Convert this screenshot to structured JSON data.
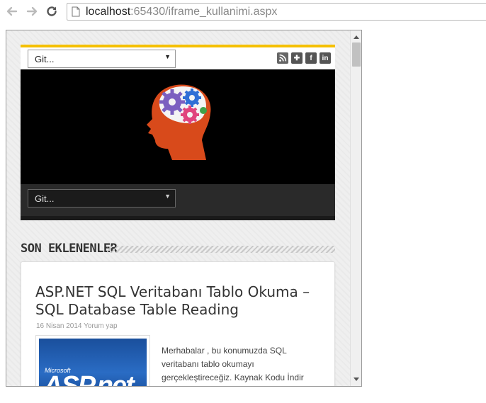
{
  "browser": {
    "url_host": "localhost",
    "url_port": ":65430",
    "url_path": "/iframe_kullanimi.aspx"
  },
  "site": {
    "select_top": "Git...",
    "select_bottom": "Git...",
    "social_icons": [
      "rss-icon",
      "plus-icon",
      "facebook-icon",
      "linkedin-icon"
    ]
  },
  "section": {
    "title": "SON EKLENENLER"
  },
  "post": {
    "title": "ASP.NET SQL Veritabanı Tablo Okuma – SQL Database Table Reading",
    "date": "16 Nisan 2014",
    "comment": "Yorum yap",
    "thumb_brand": "Microsoft",
    "thumb_text": "ASP.net",
    "excerpt": "Merhabalar , bu konumuzda  SQL veritabanı  tablo okumayı gerçekleştireceğiz. Kaynak Kodu İndir"
  },
  "colors": {
    "accent": "#f5c000",
    "header_bg": "#000000",
    "navbar_bg": "#2a2a2a"
  }
}
